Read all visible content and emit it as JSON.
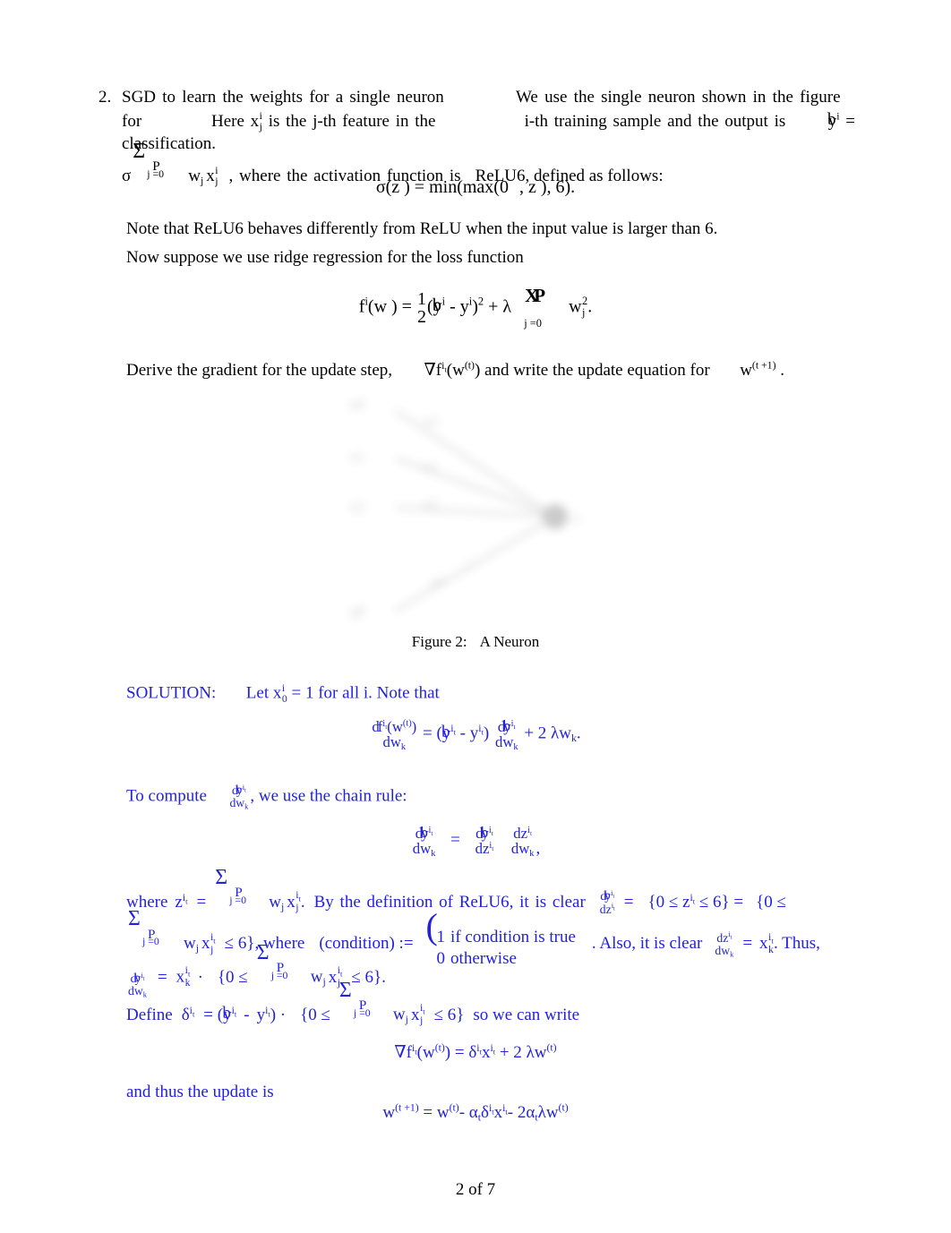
{
  "document": {
    "page_footer": "2 of 7"
  },
  "problem": {
    "number": "2.",
    "line1_a": "SGD to learn the weights for a single neuron",
    "line1_b": "We use the single neuron shown in the figure",
    "line2_a": "for classification.",
    "line2_b": "Here x",
    "line2_sub": "j",
    "line2_sup": "i",
    "line2_c": "is the",
    "line2_d": "j",
    "line2_e": "-th feature in the",
    "line2_f": "i",
    "line2_g": "-th training sample and the output is",
    "line2_h": "y",
    "line2_h_sup": "i",
    "line2_i": "=",
    "line3_sigma": "σ",
    "line3_sum_symbol": "Σ",
    "line3_sum_upper": "P",
    "line3_sum_lower": "j =0",
    "line3_body": "w",
    "line3_body_sub": "j",
    "line3_body2": "x",
    "line3_body2_sub": "j",
    "line3_body2_sup": "i",
    "line3_tail_a": ", where the activation function is",
    "line3_relu": "ReLU6",
    "line3_tail_b": ", defined as follows:"
  },
  "equations": {
    "sigma_def": {
      "lhs": "σ(z ) =",
      "rhs": "min(max(0",
      "rhs2": ", z ), 6)."
    },
    "loss": {
      "f": "f",
      "f_sup": "i",
      "paren_w": "(w ) =",
      "half_num": "1",
      "half_den": "2",
      "open": "(",
      "yhat": "y",
      "yhat_sup": "i",
      "minus": "-",
      "y": "y",
      "y_sup": "i",
      "close_sq": ")",
      "sq": "2",
      "plus_lambda": "+ λ",
      "sum_xp": "XP",
      "sum_lower": "j =0",
      "w": "w",
      "w_sub": "j",
      "w_sup": "2",
      "period": "."
    },
    "gradient_final": {
      "nabla": "∇f",
      "sup_it": "i",
      "sup_it_sub": "t",
      "arg": "(w",
      "arg_sup": "(t)",
      "arg_close": ") =",
      "delta": "δ",
      "delta_sup_i": "i",
      "delta_sup_t": "t",
      "x": "x",
      "x_sup_i": "i",
      "x_sup_t": "t",
      "tail": "+ 2 λw",
      "tail_sup": "(t)"
    },
    "update_final": {
      "lhs": "w",
      "lhs_sup": "(t +1)",
      "eq": "=",
      "w": "w",
      "w_sup": "(t)",
      "minus1": "-",
      "alpha": "α",
      "alpha_sub": "t",
      "delta": "δ",
      "delta_sup_i": "i",
      "delta_sup_t": "t",
      "x": "x",
      "x_sup_i": "i",
      "x_sup_t": "t",
      "minus2": "-",
      "two_alpha": "2α",
      "two_alpha_sub": "t",
      "lambda_w": "λw",
      "lambda_w_sup": "(t)"
    }
  },
  "body": {
    "note_relu6": "Note that ReLU6 behaves differently from ReLU when the input value is larger than 6.",
    "now_suppose": "Now suppose we use ridge regression for the loss function",
    "derive_a": "Derive the gradient for the update step,",
    "derive_nabla": "∇f",
    "derive_sup_i": "i",
    "derive_sup_t": "t",
    "derive_arg": "(w",
    "derive_arg_sup": "(t)",
    "derive_arg_close": ")",
    "derive_b": "and write the update equation for",
    "derive_w": "w",
    "derive_w_sup": "(t +1)",
    "derive_period": "."
  },
  "figure": {
    "caption_label": "Figure 2:",
    "caption_text": "A Neuron",
    "alt": "blurred diagram of a single neuron with input nodes on the left connected by edges to one output node on the right"
  },
  "solution": {
    "color": "#2222dd",
    "heading": "SOLUTION:",
    "intro_a": "Let",
    "intro_x": "x",
    "intro_x_sub": "0",
    "intro_x_sup": "i",
    "intro_b": "= 1 for all",
    "intro_i": "i",
    "intro_c": ". Note that",
    "eq1": {
      "num_d": "d",
      "num_f": "f",
      "num_sup_i": "i",
      "num_sup_t": "t",
      "num_arg": "(w",
      "num_arg_sup": "(t)",
      "num_arg_close": ")",
      "den": "dw",
      "den_sub": "k",
      "eq": "=",
      "open": "(",
      "yhat": "y",
      "yhat_sup_i": "i",
      "yhat_sup_t": "t",
      "minus": "-",
      "y": "y",
      "y_sup_i": "i",
      "y_sup_t": "t",
      "close": ")",
      "f2num_d": "d",
      "f2num_y": "y",
      "f2num_sup_i": "i",
      "f2num_sup_t": "t",
      "f2den": "dw",
      "f2den_sub": "k",
      "tail": "+ 2 λw",
      "tail_sub": "k",
      "period": "."
    },
    "to_compute_a": "To compute",
    "to_compute_frac_num_d": "d",
    "to_compute_frac_num_y": "y",
    "to_compute_frac_num_sup_i": "i",
    "to_compute_frac_num_sup_t": "t",
    "to_compute_frac_den": "dw",
    "to_compute_frac_den_sub": "k",
    "to_compute_b": ", we use the chain rule:",
    "eq2": {
      "l_num_d": "d",
      "l_num_y": "y",
      "l_num_sup_i": "i",
      "l_num_sup_t": "t",
      "l_den": "dw",
      "l_den_sub": "k",
      "eq": "=",
      "m_num_d": "d",
      "m_num_y": "y",
      "m_num_sup_i": "i",
      "m_num_sup_t": "t",
      "m_den": "dz",
      "m_den_sup_i": "i",
      "m_den_sup_t": "t",
      "r_num": "dz",
      "r_num_sup_i": "i",
      "r_num_sup_t": "t",
      "r_den": "dw",
      "r_den_sub": "k",
      "comma": ","
    },
    "para3": {
      "where": "where",
      "z": "z",
      "z_sup_i": "i",
      "z_sup_t": "t",
      "eq": "=",
      "sum": "Σ",
      "sum_upper": "P",
      "sum_lower": "j =0",
      "w": "w",
      "w_sub": "j",
      "x": "x",
      "x_sub": "j",
      "x_sup_i": "i",
      "x_sup_t": "t",
      "period": ".",
      "bydef": "By the definition of ReLU6, it is clear",
      "d_num_d": "d",
      "d_num_y": "y",
      "d_num_sup_i": "i",
      "d_num_sup_t": "t",
      "d_den": "dz",
      "d_den_sup_i": "i",
      "d_den_sup_t": "t",
      "eq2": "=",
      "ind1": "{0 ≤  z",
      "ind1_sup_i": "i",
      "ind1_sup_t": "t",
      "ind1b": "≤  6} =",
      "ind2_open": "{0 ≤",
      "sum2": "Σ",
      "sum2_upper": "P",
      "sum2_lower": "j =0",
      "w2": "w",
      "w2_sub": "j",
      "x2": "x",
      "x2_sub": "j",
      "x2_sup_i": "i",
      "x2_sup_t": "t",
      "ind2_close": "≤  6}, where",
      "cond": "(condition) :=",
      "case1_val": "1",
      "case1_txt": "if condition is true",
      "case2_val": "0",
      "case2_txt": "otherwise",
      "also": ". Also, it is clear",
      "dz_num": "dz",
      "dz_num_sup_i": "i",
      "dz_num_sup_t": "t",
      "dz_den": "dw",
      "dz_den_sub": "k",
      "eq3": "=",
      "xk": "x",
      "xk_sub": "k",
      "xk_sup_i": "i",
      "xk_sup_t": "t",
      "thus": ". Thus,"
    },
    "eq3": {
      "num_d": "d",
      "num_y": "y",
      "num_sup_i": "i",
      "num_sup_t": "t",
      "den": "dw",
      "den_sub": "k",
      "eq": "=",
      "x": "x",
      "x_sub": "k",
      "x_sup_i": "i",
      "x_sup_t": "t",
      "dot": "·",
      "ind_open": "{0 ≤",
      "sum": "Σ",
      "sum_upper": "P",
      "sum_lower": "j =0",
      "w": "w",
      "w_sub": "j",
      "x2": "x",
      "x2_sub": "j",
      "x2_sup_i": "i",
      "x2_sup_t": "t",
      "ind_close": "≤  6}."
    },
    "define": {
      "lead": "Define",
      "delta": "δ",
      "delta_sup_i": "i",
      "delta_sup_t": "t",
      "eq": "= (",
      "yhat": "y",
      "yhat_sup_i": "i",
      "yhat_sup_t": "t",
      "minus": "-",
      "y": "y",
      "y_sup_i": "i",
      "y_sup_t": "t",
      "close": ") ·",
      "ind_open": "{0 ≤",
      "sum": "Σ",
      "sum_upper": "P",
      "sum_lower": "j =0",
      "w": "w",
      "w_sub": "j",
      "x": "x",
      "x_sub": "j",
      "x_sup_i": "i",
      "x_sup_t": "t",
      "ind_close": "≤  6}",
      "tail": "so we can write"
    },
    "and_thus": "and thus the update is"
  }
}
